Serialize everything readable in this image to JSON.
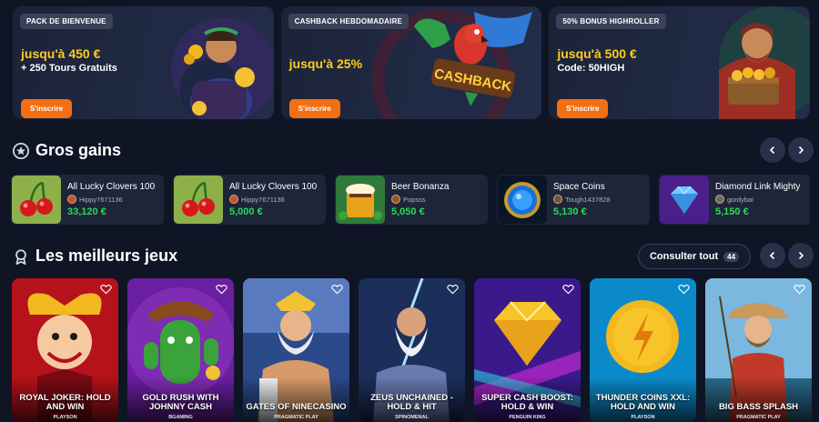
{
  "promos": [
    {
      "tag": "PACK DE BIENVENUE",
      "headline": "jusqu'à 450 €",
      "subline": "+ 250 Tours Gratuits",
      "button": "S'inscrire"
    },
    {
      "tag": "CASHBACK HEBDOMADAIRE",
      "headline": "jusqu'à 25%",
      "subline": "",
      "button": "S'inscrire",
      "art_text": "CASHBACK"
    },
    {
      "tag": "50% BONUS HIGHROLLER",
      "headline": "jusqu'à 500 €",
      "subline": "Code: 50HIGH",
      "button": "S'inscrire"
    }
  ],
  "big_wins": {
    "title": "Gros gains",
    "icon": "star-icon",
    "items": [
      {
        "game": "All Lucky Clovers 100",
        "user": "Hippy7671136",
        "amount": "33,120 €"
      },
      {
        "game": "All Lucky Clovers 100",
        "user": "Hippy7671136",
        "amount": "5,000 €"
      },
      {
        "game": "Beer Bonanza",
        "user": "Popsss",
        "amount": "5,050 €"
      },
      {
        "game": "Space Coins",
        "user": "Tough1437828",
        "amount": "5,130 €"
      },
      {
        "game": "Diamond Link Mighty",
        "user": "gordybai",
        "amount": "5,150 €"
      }
    ]
  },
  "top_games": {
    "title": "Les meilleurs jeux",
    "icon": "ribbon-icon",
    "view_all": "Consulter tout",
    "count": "44",
    "items": [
      {
        "title": "ROYAL JOKER: HOLD AND WIN",
        "provider": "PLAYSON"
      },
      {
        "title": "GOLD RUSH WITH JOHNNY CASH",
        "provider": "BGAMING"
      },
      {
        "title": "GATES OF NINECASINO",
        "provider": "PRAGMATIC PLAY"
      },
      {
        "title": "ZEUS UNCHAINED - HOLD & HIT",
        "provider": "SPINOMENAL"
      },
      {
        "title": "SUPER CASH BOOST: HOLD & WIN",
        "provider": "PENGUIN KING"
      },
      {
        "title": "THUNDER COINS XXL: HOLD AND WIN",
        "provider": "PLAYSON"
      },
      {
        "title": "BIG BASS SPLASH",
        "provider": "PRAGMATIC PLAY"
      }
    ]
  },
  "colors": {
    "background": "#0f1525",
    "accent_orange": "#f36f12",
    "headline_yellow": "#ffcc1f",
    "win_green": "#28d957"
  }
}
